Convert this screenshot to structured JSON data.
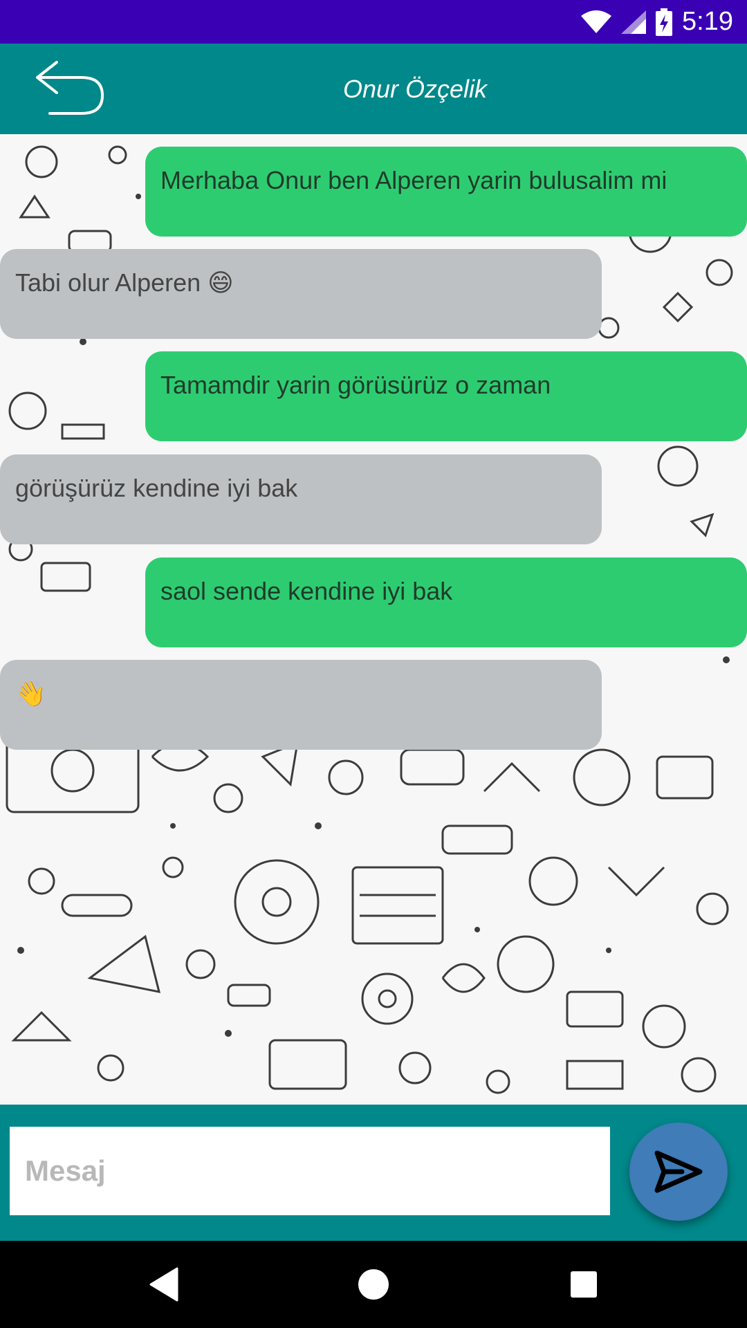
{
  "status_bar": {
    "time": "5:19",
    "icons": [
      "wifi-icon",
      "signal-icon",
      "battery-charging-icon"
    ]
  },
  "toolbar": {
    "back_icon": "back-arrow-icon",
    "title": "Onur Özçelik"
  },
  "messages": [
    {
      "direction": "outgoing",
      "text": "Merhaba Onur ben Alperen yarin bulusalim mi"
    },
    {
      "direction": "incoming",
      "text": "Tabi olur Alperen 😄"
    },
    {
      "direction": "outgoing",
      "text": "Tamamdir yarin görüsürüz o zaman"
    },
    {
      "direction": "incoming",
      "text": "görüşürüz kendine iyi bak"
    },
    {
      "direction": "outgoing",
      "text": "saol sende kendine iyi bak"
    },
    {
      "direction": "incoming",
      "text": "👋"
    }
  ],
  "composer": {
    "placeholder": "Mesaj",
    "value": "",
    "send_icon": "send-icon"
  },
  "nav": {
    "icons": [
      "back-triangle-icon",
      "home-circle-icon",
      "recents-square-icon"
    ]
  },
  "colors": {
    "status_bar": "#3a00b4",
    "toolbar": "#00888a",
    "outgoing_bubble": "#2ecc71",
    "incoming_bubble": "#bec1c4",
    "send_button": "#3f7cb8"
  }
}
